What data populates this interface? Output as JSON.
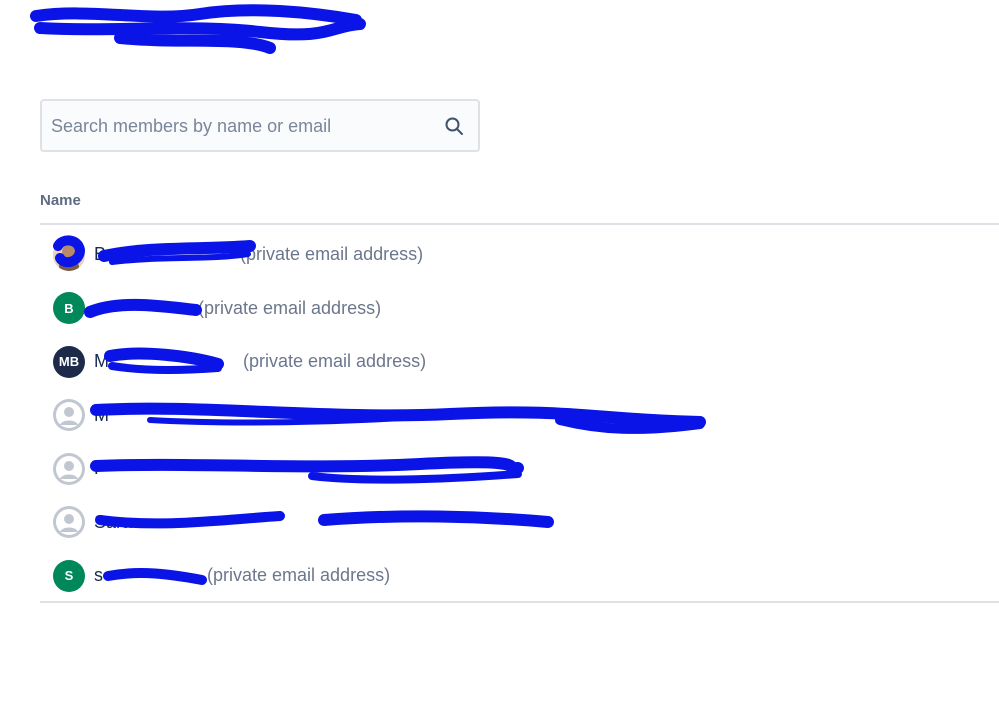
{
  "search": {
    "placeholder": "Search members by name or email",
    "icon": "search-icon"
  },
  "table": {
    "column_name": "Name"
  },
  "members": [
    {
      "avatar": "photo",
      "initials": "",
      "name": "Be",
      "note": "(private email address)"
    },
    {
      "avatar": "green",
      "initials": "B",
      "name": "",
      "note": "(private email address)"
    },
    {
      "avatar": "navy",
      "initials": "MB",
      "name": "M",
      "note": "(private email address)"
    },
    {
      "avatar": "default",
      "initials": "",
      "name": "M",
      "note": ""
    },
    {
      "avatar": "default",
      "initials": "",
      "name": "F",
      "note": ""
    },
    {
      "avatar": "default",
      "initials": "",
      "name": "Sara",
      "note": ""
    },
    {
      "avatar": "green",
      "initials": "S",
      "name": "s",
      "note": "(private email address)"
    }
  ],
  "colors": {
    "redaction": "#0a14e6",
    "avatar_green": "#00875a",
    "avatar_navy": "#1e2a4a",
    "border": "#dfe1e6"
  }
}
